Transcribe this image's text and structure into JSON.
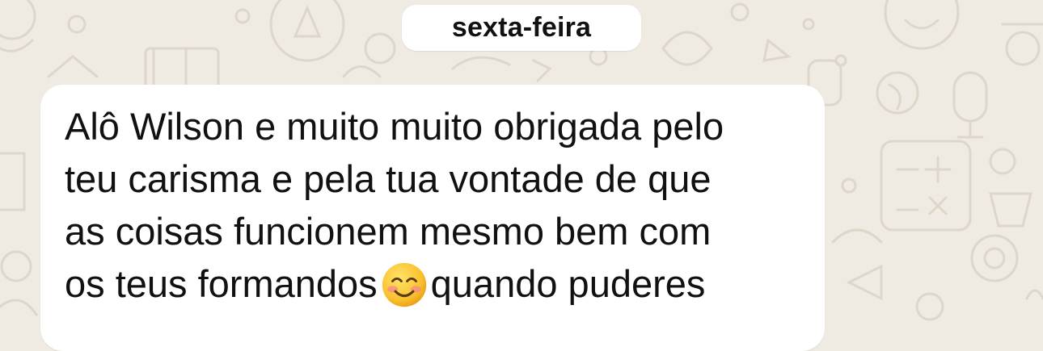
{
  "chat": {
    "date_separator": "sexta-feira",
    "message": {
      "lines": [
        "Alô Wilson e muito muito obrigada pelo",
        "teu carisma e pela tua vontade de que",
        "as coisas funcionem mesmo bem com",
        "os teus formandos",
        "quando puderes"
      ],
      "emoji": "smiling-face-icon"
    }
  },
  "colors": {
    "wallpaper": "#efeae2",
    "doodle": "#ddd6c9",
    "bubble": "#ffffff",
    "text": "#111111"
  }
}
